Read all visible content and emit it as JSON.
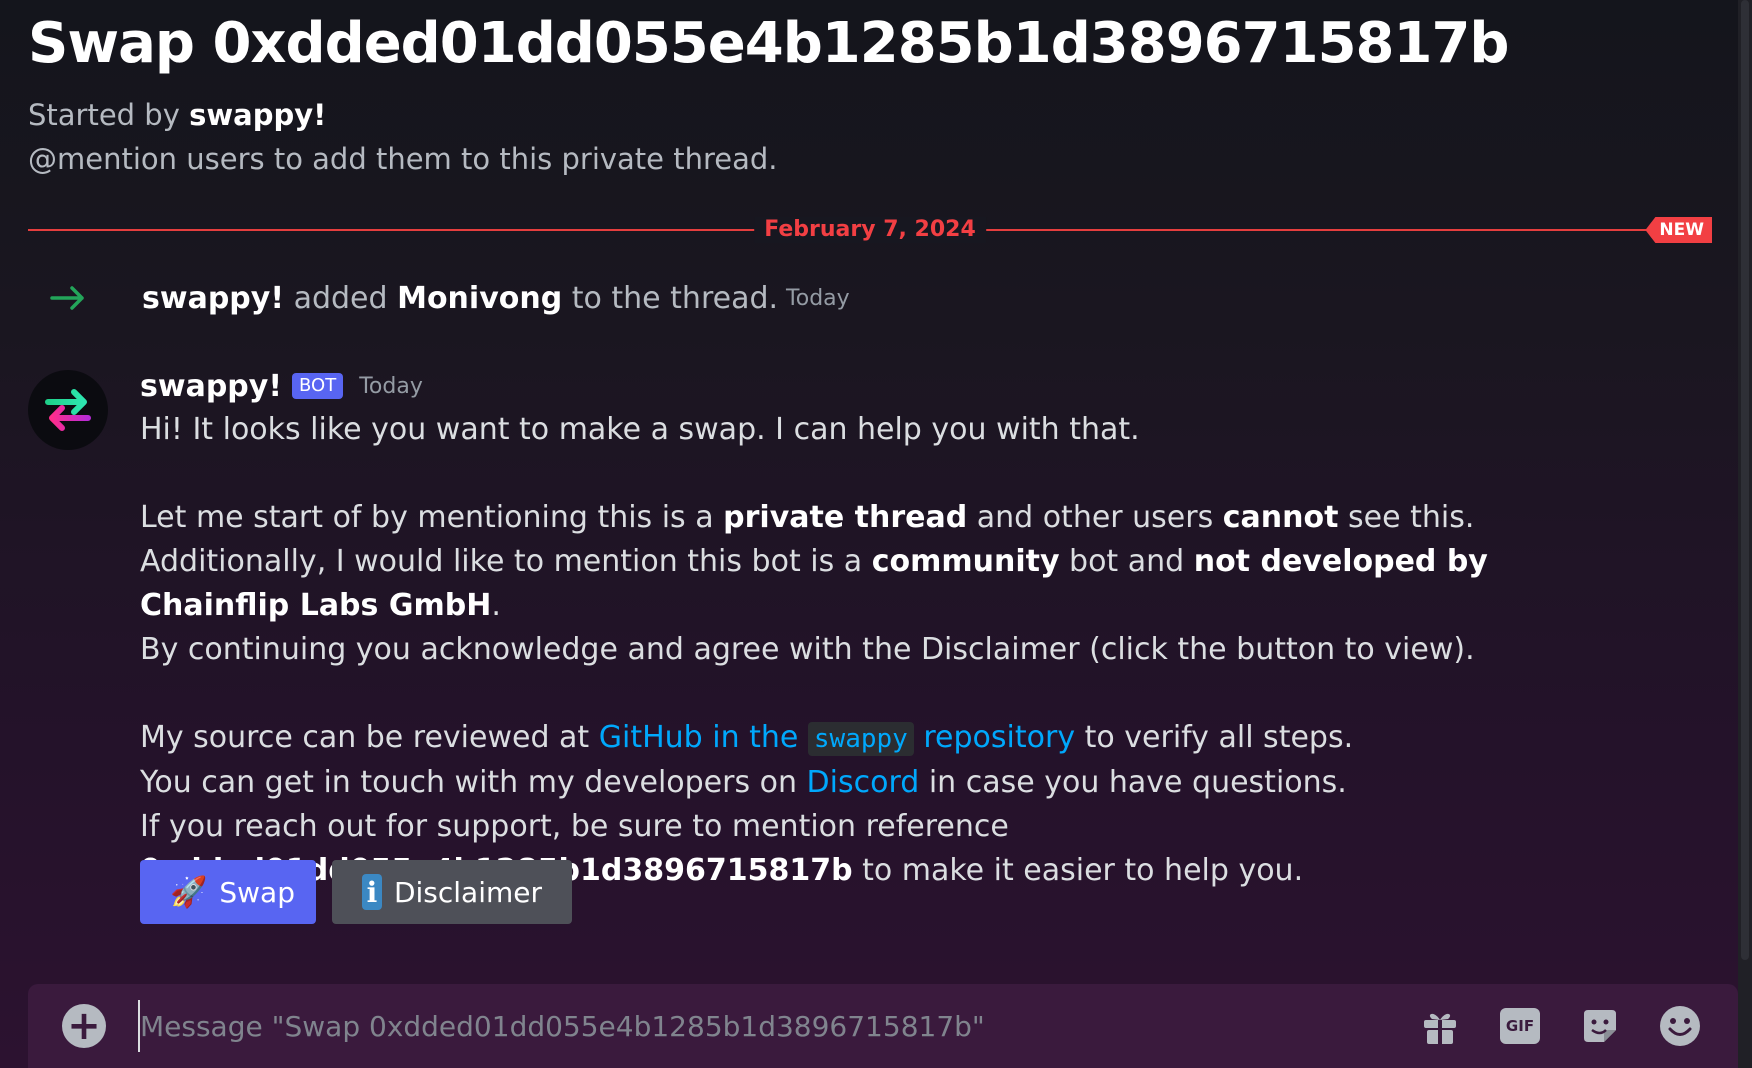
{
  "thread": {
    "title": "Swap 0xdded01dd055e4b1285b1d3896715817b",
    "started_prefix": "Started by",
    "started_by": "swappy!",
    "mention_hint": "@mention users to add them to this private thread."
  },
  "divider": {
    "date": "February 7, 2024",
    "new_badge": "NEW"
  },
  "system_message": {
    "actor": "swappy!",
    "verb": "added",
    "target": "Monivong",
    "suffix": "to the thread.",
    "time": "Today"
  },
  "message": {
    "author": "swappy!",
    "tag": "BOT",
    "time": "Today",
    "line1": "Hi! It looks like you want to make a swap. I can help you with that.",
    "p2": {
      "a": "Let me start of by mentioning this is a ",
      "b": "private thread",
      "c": " and other users ",
      "d": "cannot",
      "e": " see this."
    },
    "p3": {
      "a": "Additionally, I would like to mention this bot is a ",
      "b": "community",
      "c": " bot and ",
      "d": "not developed by Chainflip Labs GmbH",
      "e": "."
    },
    "p4": "By continuing you acknowledge and agree with the Disclaimer (click the button to view).",
    "p5": {
      "a": "My source can be reviewed at ",
      "link1": "GitHub in the",
      "code": "swappy",
      "link2": "repository",
      "b": " to verify all steps."
    },
    "p6": {
      "a": "You can get in touch with my developers on ",
      "link": "Discord",
      "b": " in case you have questions."
    },
    "p7": {
      "a": "If you reach out for support, be sure to mention reference ",
      "ref": "0xdded01dd055e4b1285b1d3896715817b",
      "b": " to make it easier to help you."
    },
    "buttons": {
      "swap_label": "Swap",
      "disclaimer_label": "Disclaimer"
    }
  },
  "composer": {
    "placeholder": "Message \"Swap 0xdded01dd055e4b1285b1d3896715817b\"",
    "gif_label": "GIF"
  },
  "colors": {
    "accent": "#5865f2",
    "new_red": "#f23f43",
    "link": "#00a8fc",
    "online_green": "#23a55a"
  }
}
